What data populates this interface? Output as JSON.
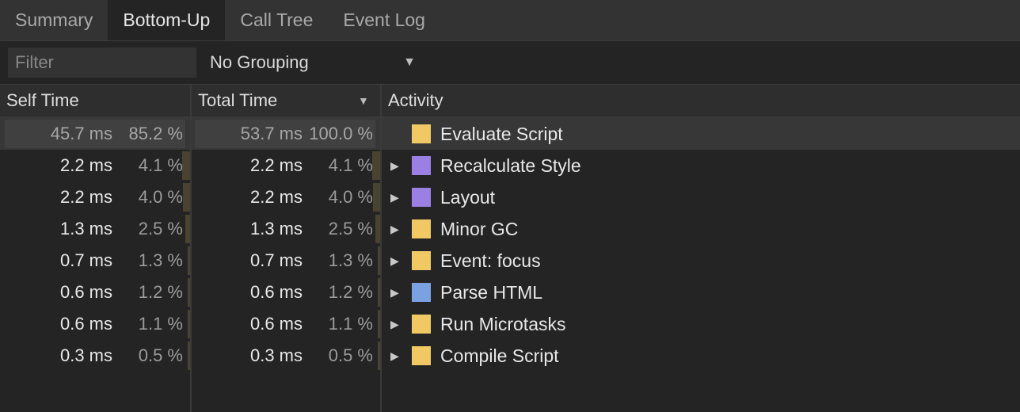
{
  "tabs": [
    {
      "label": "Summary",
      "active": false
    },
    {
      "label": "Bottom-Up",
      "active": true
    },
    {
      "label": "Call Tree",
      "active": false
    },
    {
      "label": "Event Log",
      "active": false
    }
  ],
  "toolbar": {
    "filter_placeholder": "Filter",
    "filter_value": "",
    "grouping_value": "No Grouping"
  },
  "columns": {
    "self_time": "Self Time",
    "total_time": "Total Time",
    "activity": "Activity"
  },
  "colors": {
    "scripting": "#f0c965",
    "rendering": "#9b7fe3",
    "loading": "#7aa2e0"
  },
  "rows": [
    {
      "self_ms": "45.7 ms",
      "self_pct": "85.2 %",
      "self_frac": 0.852,
      "total_ms": "53.7 ms",
      "total_pct": "100.0 %",
      "total_frac": 1.0,
      "activity": "Evaluate Script",
      "category": "scripting",
      "expandable": false,
      "selected": true
    },
    {
      "self_ms": "2.2 ms",
      "self_pct": "4.1 %",
      "self_frac": 0.041,
      "total_ms": "2.2 ms",
      "total_pct": "4.1 %",
      "total_frac": 0.041,
      "activity": "Recalculate Style",
      "category": "rendering",
      "expandable": true,
      "selected": false
    },
    {
      "self_ms": "2.2 ms",
      "self_pct": "4.0 %",
      "self_frac": 0.04,
      "total_ms": "2.2 ms",
      "total_pct": "4.0 %",
      "total_frac": 0.04,
      "activity": "Layout",
      "category": "rendering",
      "expandable": true,
      "selected": false
    },
    {
      "self_ms": "1.3 ms",
      "self_pct": "2.5 %",
      "self_frac": 0.025,
      "total_ms": "1.3 ms",
      "total_pct": "2.5 %",
      "total_frac": 0.025,
      "activity": "Minor GC",
      "category": "scripting",
      "expandable": true,
      "selected": false
    },
    {
      "self_ms": "0.7 ms",
      "self_pct": "1.3 %",
      "self_frac": 0.013,
      "total_ms": "0.7 ms",
      "total_pct": "1.3 %",
      "total_frac": 0.013,
      "activity": "Event: focus",
      "category": "scripting",
      "expandable": true,
      "selected": false
    },
    {
      "self_ms": "0.6 ms",
      "self_pct": "1.2 %",
      "self_frac": 0.012,
      "total_ms": "0.6 ms",
      "total_pct": "1.2 %",
      "total_frac": 0.012,
      "activity": "Parse HTML",
      "category": "loading",
      "expandable": true,
      "selected": false
    },
    {
      "self_ms": "0.6 ms",
      "self_pct": "1.1 %",
      "self_frac": 0.011,
      "total_ms": "0.6 ms",
      "total_pct": "1.1 %",
      "total_frac": 0.011,
      "activity": "Run Microtasks",
      "category": "scripting",
      "expandable": true,
      "selected": false
    },
    {
      "self_ms": "0.3 ms",
      "self_pct": "0.5 %",
      "self_frac": 0.005,
      "total_ms": "0.3 ms",
      "total_pct": "0.5 %",
      "total_frac": 0.005,
      "activity": "Compile Script",
      "category": "scripting",
      "expandable": true,
      "selected": false
    }
  ]
}
